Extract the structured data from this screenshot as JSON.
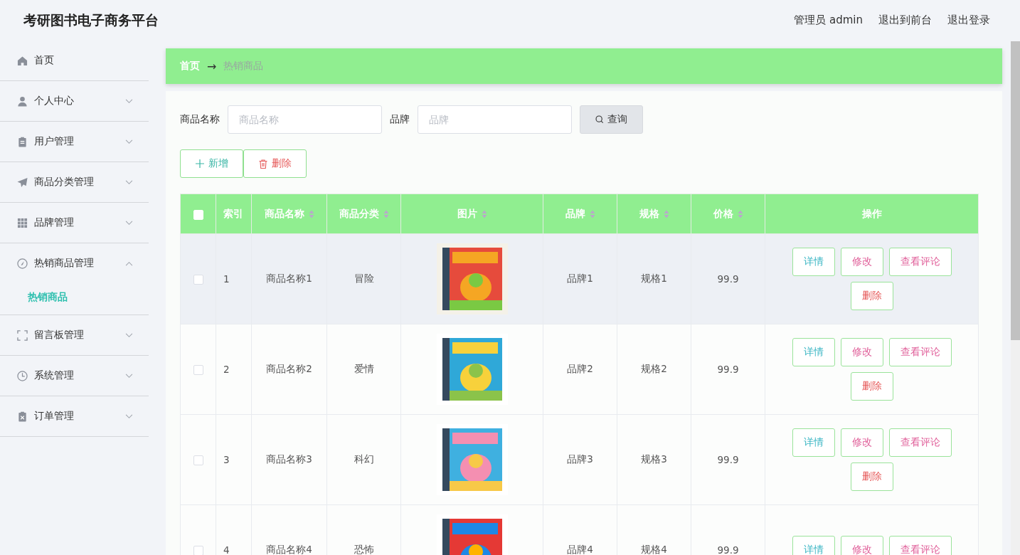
{
  "app_title": "考研图书电子商务平台",
  "header_links": [
    "管理员 admin",
    "退出到前台",
    "退出登录"
  ],
  "sidebar": {
    "items": [
      {
        "label": "首页",
        "expandable": false
      },
      {
        "label": "个人中心",
        "expandable": true,
        "expanded": false
      },
      {
        "label": "用户管理",
        "expandable": true,
        "expanded": false
      },
      {
        "label": "商品分类管理",
        "expandable": true,
        "expanded": false
      },
      {
        "label": "品牌管理",
        "expandable": true,
        "expanded": false
      },
      {
        "label": "热销商品管理",
        "expandable": true,
        "expanded": true,
        "children": [
          {
            "label": "热销商品",
            "selected": true
          }
        ]
      },
      {
        "label": "留言板管理",
        "expandable": true,
        "expanded": false
      },
      {
        "label": "系统管理",
        "expandable": true,
        "expanded": false
      },
      {
        "label": "订单管理",
        "expandable": true,
        "expanded": false
      }
    ]
  },
  "breadcrumb": [
    {
      "label": "首页"
    },
    {
      "label": "热销商品"
    }
  ],
  "breadcrumb_separator": "→",
  "search": {
    "fields": [
      {
        "label": "商品名称",
        "placeholder": "商品名称"
      },
      {
        "label": "品牌",
        "placeholder": "品牌"
      }
    ],
    "button": "查询"
  },
  "toolbar": [
    {
      "kind": "add",
      "label": "新增"
    },
    {
      "kind": "delete",
      "label": "删除"
    }
  ],
  "table": {
    "header_checked": false,
    "columns": [
      {
        "label": "索引",
        "sortable": false
      },
      {
        "label": "商品名称",
        "sortable": true
      },
      {
        "label": "商品分类",
        "sortable": true
      },
      {
        "label": "图片",
        "sortable": true
      },
      {
        "label": "品牌",
        "sortable": true
      },
      {
        "label": "规格",
        "sortable": true
      },
      {
        "label": "价格",
        "sortable": true
      },
      {
        "label": "操作",
        "sortable": false
      }
    ],
    "rows": [
      {
        "checked": false,
        "hovered": true,
        "index": "1",
        "name": "商品名称1",
        "category": "冒险",
        "brand": "品牌1",
        "spec": "规格1",
        "price": "99.9",
        "actions": [
          {
            "kind": "detail",
            "label": "详情"
          },
          {
            "kind": "edit",
            "label": "修改"
          },
          {
            "kind": "edit",
            "label": "查看评论"
          },
          {
            "kind": "delete",
            "label": "删除"
          }
        ]
      },
      {
        "checked": false,
        "hovered": false,
        "index": "2",
        "name": "商品名称2",
        "category": "爱情",
        "brand": "品牌2",
        "spec": "规格2",
        "price": "99.9",
        "actions": [
          {
            "kind": "detail",
            "label": "详情"
          },
          {
            "kind": "edit",
            "label": "修改"
          },
          {
            "kind": "edit",
            "label": "查看评论"
          },
          {
            "kind": "delete",
            "label": "删除"
          }
        ]
      },
      {
        "checked": false,
        "hovered": false,
        "index": "3",
        "name": "商品名称3",
        "category": "科幻",
        "brand": "品牌3",
        "spec": "规格3",
        "price": "99.9",
        "actions": [
          {
            "kind": "detail",
            "label": "详情"
          },
          {
            "kind": "edit",
            "label": "修改"
          },
          {
            "kind": "edit",
            "label": "查看评论"
          },
          {
            "kind": "delete",
            "label": "删除"
          }
        ]
      },
      {
        "checked": false,
        "hovered": false,
        "index": "4",
        "name": "商品名称4",
        "category": "恐怖",
        "brand": "品牌4",
        "spec": "规格4",
        "price": "99.9",
        "actions": [
          {
            "kind": "detail",
            "label": "详情"
          },
          {
            "kind": "edit",
            "label": "修改"
          },
          {
            "kind": "edit",
            "label": "查看评论"
          }
        ]
      }
    ]
  }
}
